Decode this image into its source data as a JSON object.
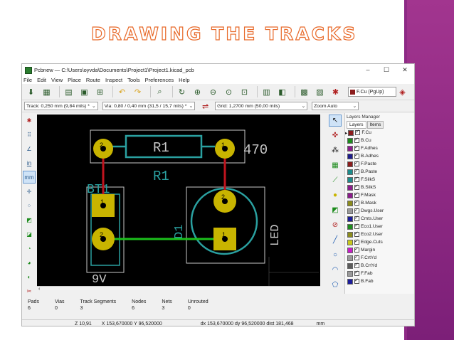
{
  "slide": {
    "title": "DRAWING THE TRACKS",
    "accent_color": "#8d2a85"
  },
  "window": {
    "title": "Pcbnew — C:\\Users\\oyvda\\Documents\\Project1\\Project1.kicad_pcb",
    "controls": [
      "–",
      "☐",
      "✕"
    ]
  },
  "menu": {
    "items": [
      "File",
      "Edit",
      "View",
      "Place",
      "Route",
      "Inspect",
      "Tools",
      "Preferences",
      "Help"
    ]
  },
  "toolbar": {
    "active_layer": "F.Cu (PgUp)",
    "track": "Track: 0,250 mm (9,84 mils) *",
    "via": "Via: 0,80 / 0,40 mm (31,5 / 15,7 mils) *",
    "grid": "Grid: 1,2700 mm (50,00 mils)",
    "zoom": "Zoom Auto"
  },
  "left_tools": {
    "units_in": "in",
    "units_mm": "mm"
  },
  "pcb": {
    "r1_ref_top": "R1",
    "r1_ref_bottom": "R1",
    "r1_value": "470",
    "bt1_ref": "BT1",
    "bt1_value": "9V",
    "d1_ref": "D1",
    "d1_value": "LED",
    "pad1": "1",
    "pad2": "2"
  },
  "layers_panel": {
    "title": "Layers Manager",
    "tabs": [
      "Layers",
      "Items"
    ],
    "layers": [
      {
        "name": "F.Cu",
        "color": "#8b1c1c"
      },
      {
        "name": "B.Cu",
        "color": "#1c8b1c"
      },
      {
        "name": "F.Adhes",
        "color": "#8b1c8b"
      },
      {
        "name": "B.Adhes",
        "color": "#1c1c8b"
      },
      {
        "name": "F.Paste",
        "color": "#8b1c1c"
      },
      {
        "name": "B.Paste",
        "color": "#1c8b8b"
      },
      {
        "name": "F.SilkS",
        "color": "#1c8b8b"
      },
      {
        "name": "B.SilkS",
        "color": "#8b1c8b"
      },
      {
        "name": "F.Mask",
        "color": "#8b1c8b"
      },
      {
        "name": "B.Mask",
        "color": "#8b8b1c"
      },
      {
        "name": "Dwgs.User",
        "color": "#9a9a9a"
      },
      {
        "name": "Cmts.User",
        "color": "#1c1c9a"
      },
      {
        "name": "Eco1.User",
        "color": "#1c8b1c"
      },
      {
        "name": "Eco2.User",
        "color": "#8b8b1c"
      },
      {
        "name": "Edge.Cuts",
        "color": "#c8c81c"
      },
      {
        "name": "Margin",
        "color": "#c81cc8"
      },
      {
        "name": "F.CrtYd",
        "color": "#9a9a9a"
      },
      {
        "name": "B.CrtYd",
        "color": "#5a5a5a"
      },
      {
        "name": "F.Fab",
        "color": "#9a9a9a"
      },
      {
        "name": "B.Fab",
        "color": "#1c1c9a"
      }
    ]
  },
  "stats": [
    {
      "label": "Pads",
      "value": "6"
    },
    {
      "label": "Vias",
      "value": "0"
    },
    {
      "label": "Track Segments",
      "value": "3"
    },
    {
      "label": "Nodes",
      "value": "6"
    },
    {
      "label": "Nets",
      "value": "3"
    },
    {
      "label": "Unrouted",
      "value": "0"
    }
  ],
  "statusbar": {
    "zoom": "Z 10,91",
    "xy": "X 153,670000  Y 96,520000",
    "dxy": "dx 153,670000  dy 96,520000  dist 181,468",
    "units": "mm"
  }
}
